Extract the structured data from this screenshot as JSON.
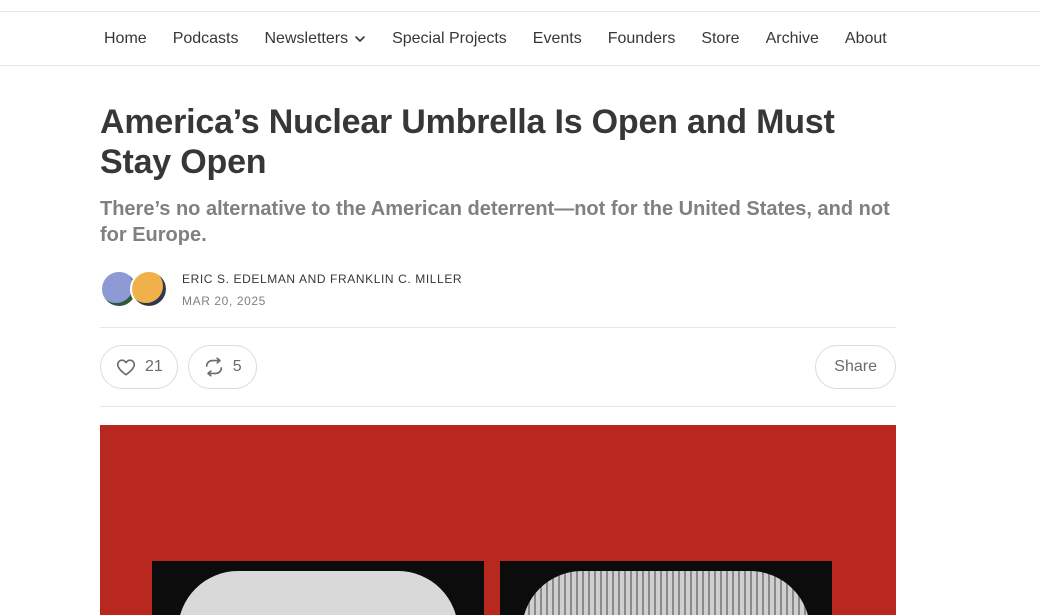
{
  "nav": {
    "items": [
      {
        "label": "Home"
      },
      {
        "label": "Podcasts"
      },
      {
        "label": "Newsletters",
        "has_dropdown": true
      },
      {
        "label": "Special Projects"
      },
      {
        "label": "Events"
      },
      {
        "label": "Founders"
      },
      {
        "label": "Store"
      },
      {
        "label": "Archive"
      },
      {
        "label": "About"
      }
    ]
  },
  "post": {
    "title": "America’s Nuclear Umbrella Is Open and Must Stay Open",
    "subtitle": "There’s no alternative to the American deterrent—not for the United States, and not for Europe.",
    "authors": "ERIC S. EDELMAN AND FRANKLIN C. MILLER",
    "date": "MAR 20, 2025"
  },
  "actions": {
    "like_count": "21",
    "restack_count": "5",
    "share_label": "Share"
  },
  "icons": {
    "like": "heart-icon",
    "restack": "restack-icon",
    "dropdown": "chevron-down-icon"
  },
  "colors": {
    "hero_background": "#b8281f",
    "text": "#363737",
    "muted": "#808080"
  }
}
